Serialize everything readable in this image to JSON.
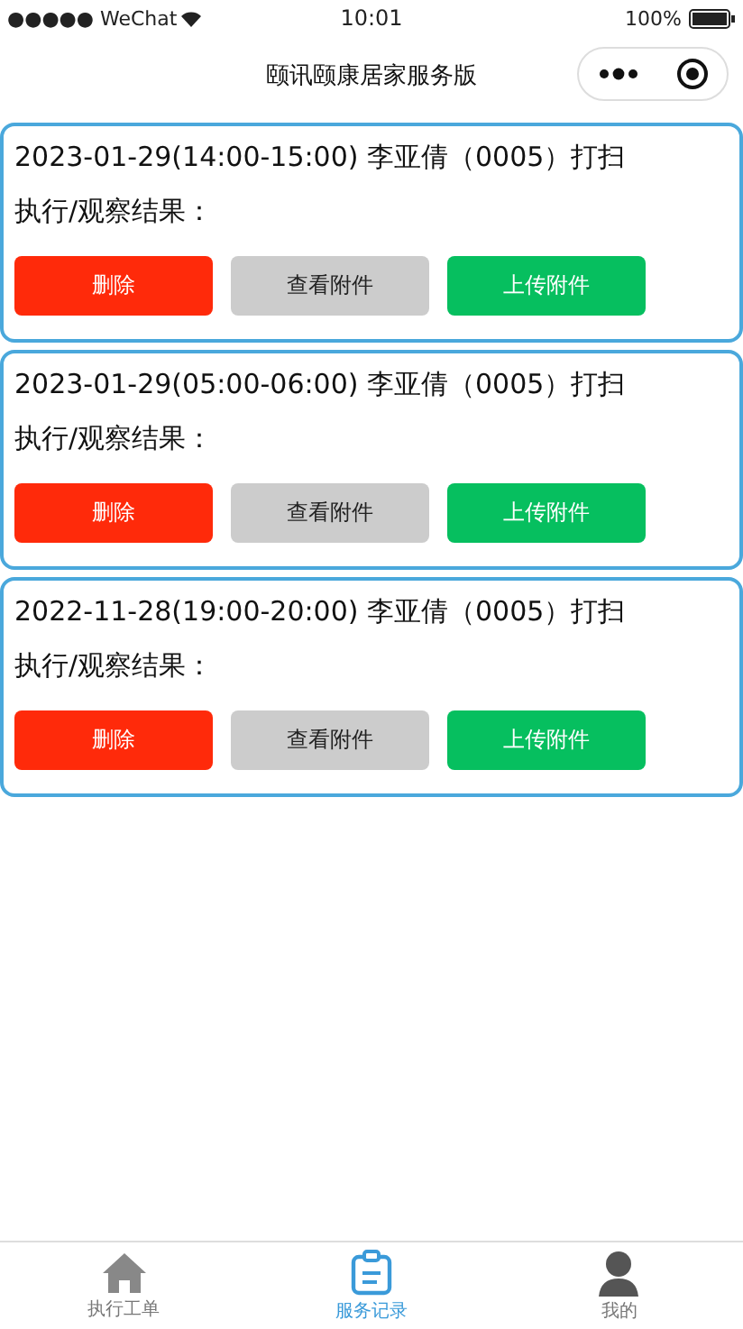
{
  "status_bar": {
    "carrier": "●●●●● WeChat",
    "time": "10:01",
    "battery": "100%"
  },
  "nav": {
    "title": "颐讯颐康居家服务版"
  },
  "records": [
    {
      "heading": "2023-01-29(14:00-15:00)  李亚倩（0005）打扫",
      "result_label": "执行/观察结果：",
      "buttons": [
        {
          "kind": "delete",
          "label": "删除"
        },
        {
          "kind": "view",
          "label": "查看附件"
        },
        {
          "kind": "upload",
          "label": "上传附件"
        }
      ]
    },
    {
      "heading": "2023-01-29(05:00-06:00)  李亚倩（0005）打扫",
      "result_label": "执行/观察结果：",
      "buttons": [
        {
          "kind": "delete",
          "label": "删除"
        },
        {
          "kind": "view",
          "label": "查看附件"
        },
        {
          "kind": "upload",
          "label": "上传附件"
        }
      ]
    },
    {
      "heading": "2022-11-28(19:00-20:00)  李亚倩（0005）打扫",
      "result_label": "执行/观察结果：",
      "buttons": [
        {
          "kind": "delete",
          "label": "删除"
        },
        {
          "kind": "view",
          "label": "查看附件"
        },
        {
          "kind": "upload",
          "label": "上传附件"
        }
      ]
    }
  ],
  "tab_bar": [
    {
      "kind": "home",
      "label": "执行工单",
      "selected": false
    },
    {
      "kind": "clipboard",
      "label": "服务记录",
      "selected": true
    },
    {
      "kind": "person",
      "label": "我的",
      "selected": false
    }
  ]
}
